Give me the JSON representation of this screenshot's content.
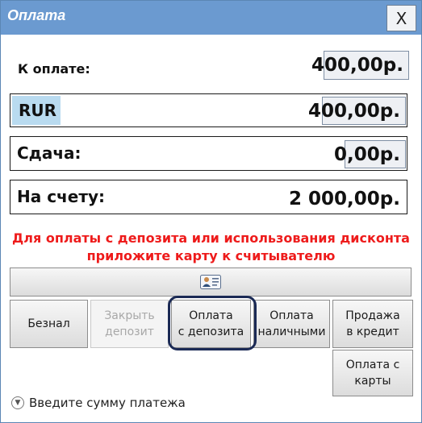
{
  "dialog": {
    "title": "Оплата",
    "close_label": "X"
  },
  "to_pay": {
    "label": "К оплате:",
    "value": "400,00р."
  },
  "currency": {
    "code": "RUR",
    "value": "400,00р."
  },
  "change": {
    "label": "Сдача:",
    "value": "0,00р."
  },
  "balance": {
    "label": "На счету:",
    "value": "2 000,00р."
  },
  "hint": {
    "line1": "Для оплаты с депозита или использования дисконта",
    "line2": "приложите карту к считывателю"
  },
  "buttons": {
    "cashless": "Безнал",
    "close_deposit_1": "Закрыть",
    "close_deposit_2": "депозит",
    "deposit_pay_1": "Оплата",
    "deposit_pay_2": "с депозита",
    "cash_pay_1": "Оплата",
    "cash_pay_2": "наличными",
    "credit_sale_1": "Продажа",
    "credit_sale_2": "в кредит",
    "card_pay_1": "Оплата с",
    "card_pay_2": "карты"
  },
  "footer": {
    "text": "Введите сумму платежа"
  },
  "colors": {
    "titlebar": "#6b9ad0",
    "hint": "#ee1b1b",
    "currency_highlight": "#b9dbf0",
    "focus_ring": "#1b2a55"
  }
}
